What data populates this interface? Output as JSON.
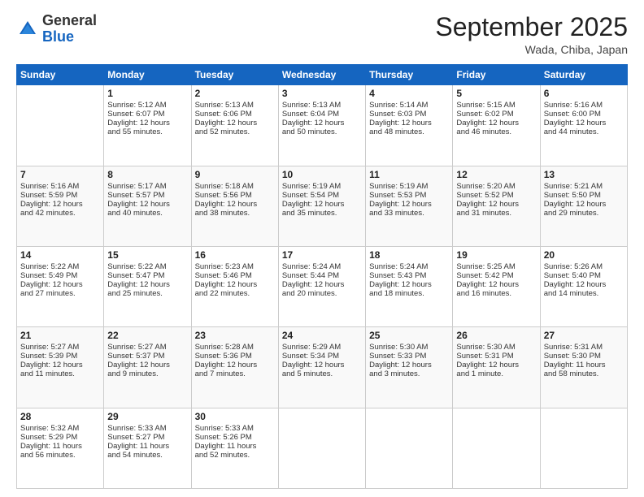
{
  "header": {
    "logo": {
      "general": "General",
      "blue": "Blue"
    },
    "title": "September 2025",
    "location": "Wada, Chiba, Japan"
  },
  "weekdays": [
    "Sunday",
    "Monday",
    "Tuesday",
    "Wednesday",
    "Thursday",
    "Friday",
    "Saturday"
  ],
  "weeks": [
    [
      {
        "day": "",
        "data": ""
      },
      {
        "day": "1",
        "data": "Sunrise: 5:12 AM\nSunset: 6:07 PM\nDaylight: 12 hours\nand 55 minutes."
      },
      {
        "day": "2",
        "data": "Sunrise: 5:13 AM\nSunset: 6:06 PM\nDaylight: 12 hours\nand 52 minutes."
      },
      {
        "day": "3",
        "data": "Sunrise: 5:13 AM\nSunset: 6:04 PM\nDaylight: 12 hours\nand 50 minutes."
      },
      {
        "day": "4",
        "data": "Sunrise: 5:14 AM\nSunset: 6:03 PM\nDaylight: 12 hours\nand 48 minutes."
      },
      {
        "day": "5",
        "data": "Sunrise: 5:15 AM\nSunset: 6:02 PM\nDaylight: 12 hours\nand 46 minutes."
      },
      {
        "day": "6",
        "data": "Sunrise: 5:16 AM\nSunset: 6:00 PM\nDaylight: 12 hours\nand 44 minutes."
      }
    ],
    [
      {
        "day": "7",
        "data": "Sunrise: 5:16 AM\nSunset: 5:59 PM\nDaylight: 12 hours\nand 42 minutes."
      },
      {
        "day": "8",
        "data": "Sunrise: 5:17 AM\nSunset: 5:57 PM\nDaylight: 12 hours\nand 40 minutes."
      },
      {
        "day": "9",
        "data": "Sunrise: 5:18 AM\nSunset: 5:56 PM\nDaylight: 12 hours\nand 38 minutes."
      },
      {
        "day": "10",
        "data": "Sunrise: 5:19 AM\nSunset: 5:54 PM\nDaylight: 12 hours\nand 35 minutes."
      },
      {
        "day": "11",
        "data": "Sunrise: 5:19 AM\nSunset: 5:53 PM\nDaylight: 12 hours\nand 33 minutes."
      },
      {
        "day": "12",
        "data": "Sunrise: 5:20 AM\nSunset: 5:52 PM\nDaylight: 12 hours\nand 31 minutes."
      },
      {
        "day": "13",
        "data": "Sunrise: 5:21 AM\nSunset: 5:50 PM\nDaylight: 12 hours\nand 29 minutes."
      }
    ],
    [
      {
        "day": "14",
        "data": "Sunrise: 5:22 AM\nSunset: 5:49 PM\nDaylight: 12 hours\nand 27 minutes."
      },
      {
        "day": "15",
        "data": "Sunrise: 5:22 AM\nSunset: 5:47 PM\nDaylight: 12 hours\nand 25 minutes."
      },
      {
        "day": "16",
        "data": "Sunrise: 5:23 AM\nSunset: 5:46 PM\nDaylight: 12 hours\nand 22 minutes."
      },
      {
        "day": "17",
        "data": "Sunrise: 5:24 AM\nSunset: 5:44 PM\nDaylight: 12 hours\nand 20 minutes."
      },
      {
        "day": "18",
        "data": "Sunrise: 5:24 AM\nSunset: 5:43 PM\nDaylight: 12 hours\nand 18 minutes."
      },
      {
        "day": "19",
        "data": "Sunrise: 5:25 AM\nSunset: 5:42 PM\nDaylight: 12 hours\nand 16 minutes."
      },
      {
        "day": "20",
        "data": "Sunrise: 5:26 AM\nSunset: 5:40 PM\nDaylight: 12 hours\nand 14 minutes."
      }
    ],
    [
      {
        "day": "21",
        "data": "Sunrise: 5:27 AM\nSunset: 5:39 PM\nDaylight: 12 hours\nand 11 minutes."
      },
      {
        "day": "22",
        "data": "Sunrise: 5:27 AM\nSunset: 5:37 PM\nDaylight: 12 hours\nand 9 minutes."
      },
      {
        "day": "23",
        "data": "Sunrise: 5:28 AM\nSunset: 5:36 PM\nDaylight: 12 hours\nand 7 minutes."
      },
      {
        "day": "24",
        "data": "Sunrise: 5:29 AM\nSunset: 5:34 PM\nDaylight: 12 hours\nand 5 minutes."
      },
      {
        "day": "25",
        "data": "Sunrise: 5:30 AM\nSunset: 5:33 PM\nDaylight: 12 hours\nand 3 minutes."
      },
      {
        "day": "26",
        "data": "Sunrise: 5:30 AM\nSunset: 5:31 PM\nDaylight: 12 hours\nand 1 minute."
      },
      {
        "day": "27",
        "data": "Sunrise: 5:31 AM\nSunset: 5:30 PM\nDaylight: 11 hours\nand 58 minutes."
      }
    ],
    [
      {
        "day": "28",
        "data": "Sunrise: 5:32 AM\nSunset: 5:29 PM\nDaylight: 11 hours\nand 56 minutes."
      },
      {
        "day": "29",
        "data": "Sunrise: 5:33 AM\nSunset: 5:27 PM\nDaylight: 11 hours\nand 54 minutes."
      },
      {
        "day": "30",
        "data": "Sunrise: 5:33 AM\nSunset: 5:26 PM\nDaylight: 11 hours\nand 52 minutes."
      },
      {
        "day": "",
        "data": ""
      },
      {
        "day": "",
        "data": ""
      },
      {
        "day": "",
        "data": ""
      },
      {
        "day": "",
        "data": ""
      }
    ]
  ]
}
